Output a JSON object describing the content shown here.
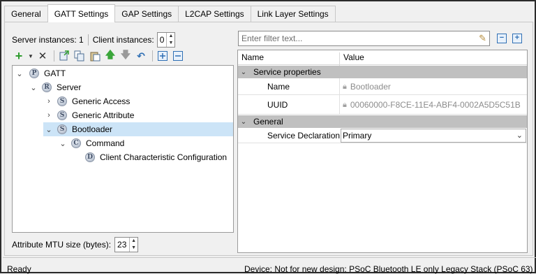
{
  "tabs": [
    {
      "label": "General",
      "active": false
    },
    {
      "label": "GATT Settings",
      "active": true
    },
    {
      "label": "GAP Settings",
      "active": false
    },
    {
      "label": "L2CAP Settings",
      "active": false
    },
    {
      "label": "Link Layer Settings",
      "active": false
    }
  ],
  "instances": {
    "server_label": "Server instances: 1",
    "client_label": "Client instances:",
    "client_value": "0"
  },
  "toolbar": {
    "icons": [
      "add-icon",
      "dropdown-arrow-icon",
      "delete-icon",
      "import-icon",
      "copy-icon",
      "paste-icon",
      "move-up-icon",
      "move-down-icon",
      "undo-icon",
      "expand-all-icon",
      "collapse-all-icon"
    ]
  },
  "tree": {
    "nodes": [
      {
        "label": "GATT",
        "badge": "P"
      },
      {
        "label": "Server",
        "badge": "R"
      },
      {
        "label": "Generic Access",
        "badge": "S"
      },
      {
        "label": "Generic Attribute",
        "badge": "S"
      },
      {
        "label": "Bootloader",
        "badge": "S",
        "selected": true
      },
      {
        "label": "Command",
        "badge": "C"
      },
      {
        "label": "Client Characteristic Configuration",
        "badge": "D"
      }
    ]
  },
  "mtu": {
    "label": "Attribute MTU size (bytes):",
    "value": "23"
  },
  "filter": {
    "placeholder": "Enter filter text..."
  },
  "grid": {
    "col_name": "Name",
    "col_value": "Value",
    "categories": [
      {
        "label": "Service properties"
      },
      {
        "label": "General"
      }
    ],
    "properties": [
      {
        "name": "Name",
        "value": "Bootloader"
      },
      {
        "name": "UUID",
        "value": "00060000-F8CE-11E4-ABF4-0002A5D5C51B"
      },
      {
        "name": "Service Declaration",
        "value": "Primary"
      }
    ]
  },
  "status": {
    "left": "Ready",
    "right": "Device: Not for new design: PSoC Bluetooth LE only Legacy Stack (PSoC 63)"
  }
}
